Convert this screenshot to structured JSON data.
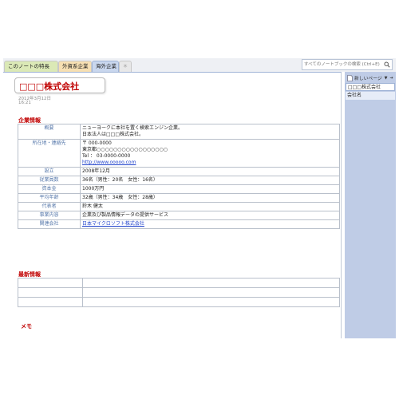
{
  "tabs": [
    {
      "label": "このノートの特長"
    },
    {
      "label": "外資系企業"
    },
    {
      "label": "海外企業"
    },
    {
      "label": "＊"
    }
  ],
  "search": {
    "placeholder": "すべてのノートブックの検索 (Ctrl+E)"
  },
  "page": {
    "title": "□□□株式会社",
    "date": "2012年3月12日",
    "time": "16:21",
    "sections": {
      "company_info": "企業情報",
      "latest_info": "最新情報",
      "memo": "メモ"
    }
  },
  "company_table": {
    "overview_label": "概要",
    "overview_line1": "ニューヨークに本社を置く検索エンジン企業。",
    "overview_line2": "日本法人は□□□株式会社。",
    "address_label": "所在地・連絡先",
    "postal": "〒 000-0000",
    "address": "東京都○○○○○○○○○○○○○○○○○",
    "tel": "Tel ： 03-0000-0000",
    "url": "http://www.ooooo.com",
    "founded_label": "設立",
    "founded": "2008年12月",
    "employees_label": "従業員数",
    "employees": "36名（男性：20名　女性：16名）",
    "capital_label": "資本金",
    "capital": "1000万円",
    "avg_age_label": "平均年齢",
    "avg_age": "32歳（男性：34歳　女性：28歳）",
    "rep_label": "代表者",
    "rep": "鈴木 健太",
    "business_label": "事業内容",
    "business": "企業及び製品情報データの提供サービス",
    "related_label": "関連会社",
    "related": "日本マイクロソフト株式会社"
  },
  "right_pane": {
    "new_page": "新しいページ",
    "pages": [
      "□□□株式会社",
      "会社名"
    ]
  }
}
